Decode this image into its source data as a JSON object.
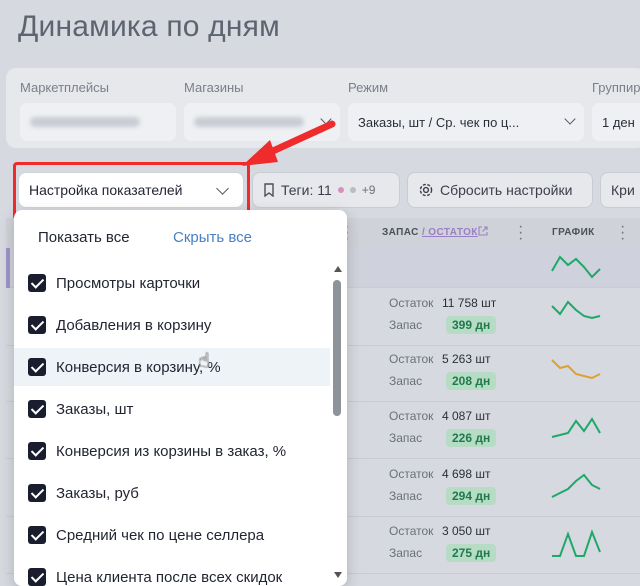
{
  "page": {
    "title": "Динамика по дням"
  },
  "filters": {
    "marketplaces_label": "Маркетплейсы",
    "stores_label": "Магазины",
    "mode_label": "Режим",
    "mode_value": "Заказы, шт / Ср. чек по ц...",
    "group_label": "Группир",
    "group_value": "1 ден"
  },
  "toolbar": {
    "settings_select": "Настройка показателей",
    "tags_label": "Теги: 11",
    "tags_more": "+9",
    "reset_label": "Сбросить настройки",
    "crit_label": "Кри"
  },
  "table": {
    "head_stock": "ЗАПАС",
    "head_remain": "/ ОСТАТОК",
    "head_chart": "ГРАФИК",
    "rows": [
      {
        "remain_label": "Остаток",
        "remain_value": "11 758 шт",
        "stock_label": "Запас",
        "days": "399 дн"
      },
      {
        "remain_label": "Остаток",
        "remain_value": "5 263 шт",
        "stock_label": "Запас",
        "days": "208 дн"
      },
      {
        "remain_label": "Остаток",
        "remain_value": "4 087 шт",
        "stock_label": "Запас",
        "days": "226 дн"
      },
      {
        "remain_label": "Остаток",
        "remain_value": "4 698 шт",
        "stock_label": "Запас",
        "days": "294 дн"
      },
      {
        "remain_label": "Остаток",
        "remain_value": "3 050 шт",
        "stock_label": "Запас",
        "days": "275 дн"
      }
    ]
  },
  "dropdown": {
    "show_all": "Показать все",
    "hide_all": "Скрыть все",
    "options": [
      "Просмотры карточки",
      "Добавления в корзину",
      "Конверсия в корзину, %",
      "Заказы, шт",
      "Конверсия из корзины в заказ, %",
      "Заказы, руб",
      "Средний чек по цене селлера",
      "Цена клиента после всех скидок"
    ]
  },
  "colors": {
    "accent_red": "#ef2b2b",
    "spark_green": "#1fa86a",
    "spark_orange": "#e0a030",
    "checkbox": "#1a1d2e"
  }
}
